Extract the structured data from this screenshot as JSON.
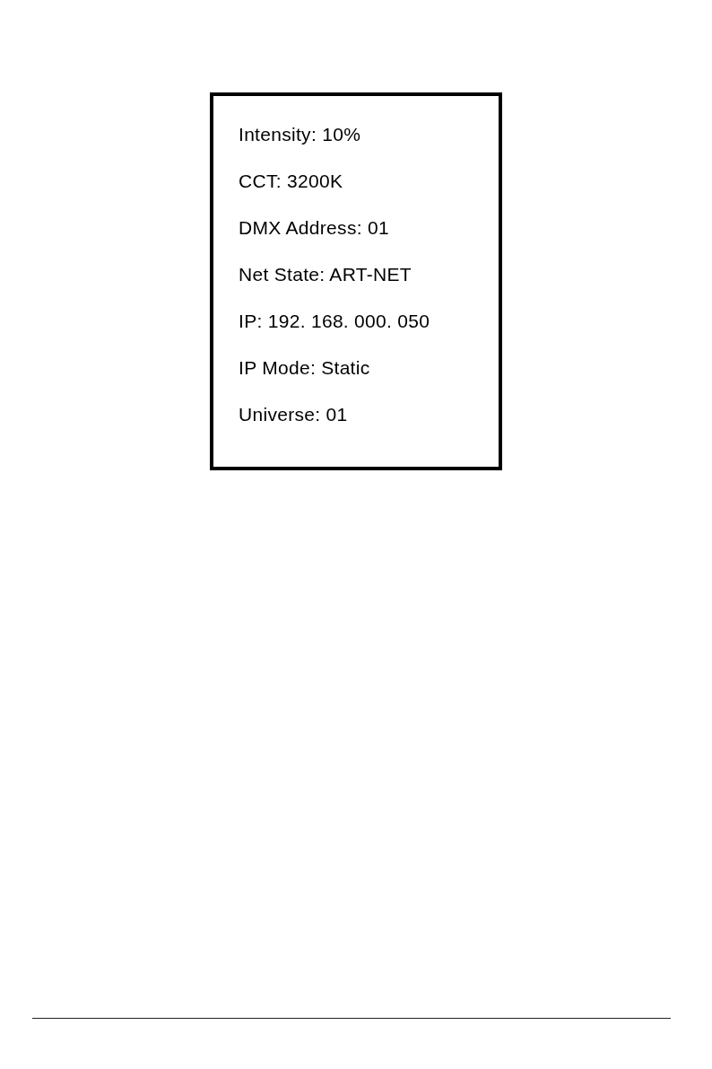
{
  "display_panel": {
    "lines": [
      "Intensity: 10%",
      "CCT: 3200K",
      "DMX Address: 01",
      "Net State: ART-NET",
      "IP: 192. 168. 000. 050",
      "IP Mode: Static",
      "Universe: 01"
    ]
  }
}
